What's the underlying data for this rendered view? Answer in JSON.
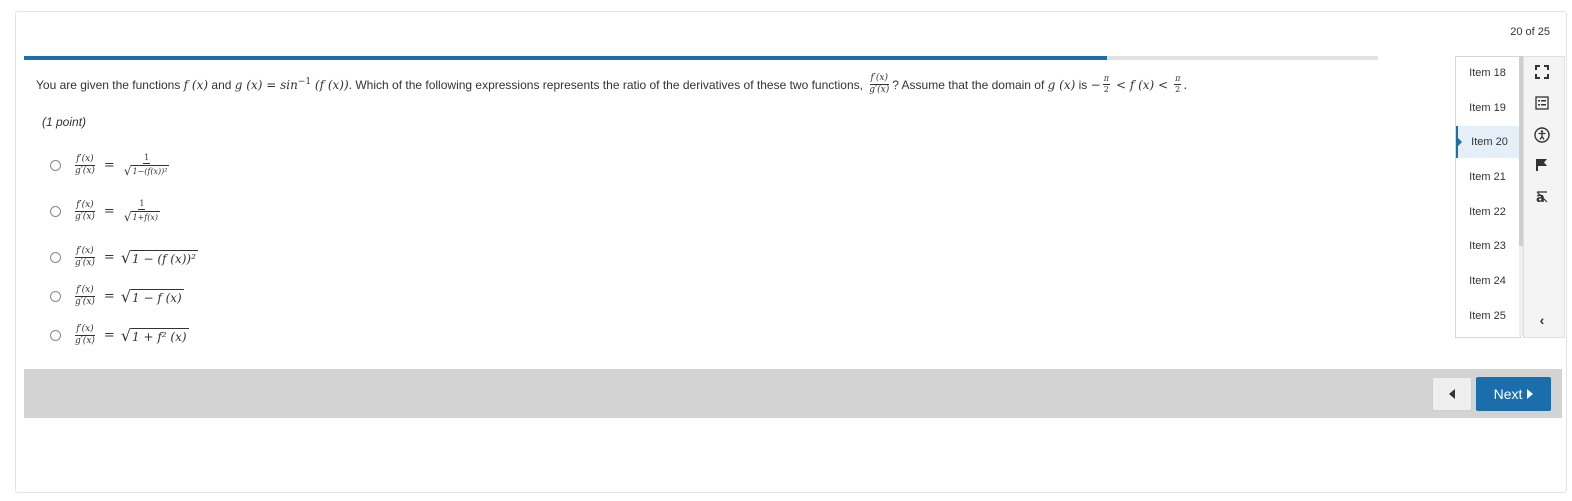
{
  "header": {
    "counter": "20 of 25"
  },
  "progress": {
    "fraction": 0.8
  },
  "question": {
    "text_intro": "You are given the functions",
    "f_x": "f (x)",
    "and": "and",
    "g_def": "g (x) = sin",
    "inv": "−1",
    "g_arg": " (f (x))",
    "middle": ". Which of the following expressions represents the ratio of the derivatives of these two functions,",
    "ratio_num": "f′(x)",
    "ratio_den": "g′(x)",
    "assume": "? Assume that the domain of",
    "domain_g": "g (x)",
    "is": "is",
    "minus": "−",
    "pi": "π",
    "two": "2",
    "lt_f": "< f (x) <",
    "period": "."
  },
  "points": "(1 point)",
  "options": [
    {
      "lhs_num": "f′(x)",
      "lhs_den": "g′(x)",
      "eq": "=",
      "rhs_num": "1",
      "radicand": "1−(f(x))²"
    },
    {
      "lhs_num": "f′(x)",
      "lhs_den": "g′(x)",
      "eq": "=",
      "rhs_num": "1",
      "radicand": "1+f(x)"
    },
    {
      "lhs_num": "f′(x)",
      "lhs_den": "g′(x)",
      "eq": "=",
      "radicand": "1 − (f (x))²"
    },
    {
      "lhs_num": "f′(x)",
      "lhs_den": "g′(x)",
      "eq": "=",
      "radicand": "1 − f (x)"
    },
    {
      "lhs_num": "f′(x)",
      "lhs_den": "g′(x)",
      "eq": "=",
      "radicand": "1 + f² (x)"
    }
  ],
  "items": [
    "Item 18",
    "Item 19",
    "Item 20",
    "Item 21",
    "Item 22",
    "Item 23",
    "Item 24",
    "Item 25"
  ],
  "active_item": "Item 20",
  "tools": [
    "fullscreen-icon",
    "notes-icon",
    "accessibility-icon",
    "flag-icon",
    "translate-icon",
    "collapse-chevron-icon"
  ],
  "nav": {
    "next_label": "Next"
  },
  "colors": {
    "accent": "#1e6fa8",
    "next_button": "#1a6eab",
    "footer_bar": "#d3d3d3"
  }
}
